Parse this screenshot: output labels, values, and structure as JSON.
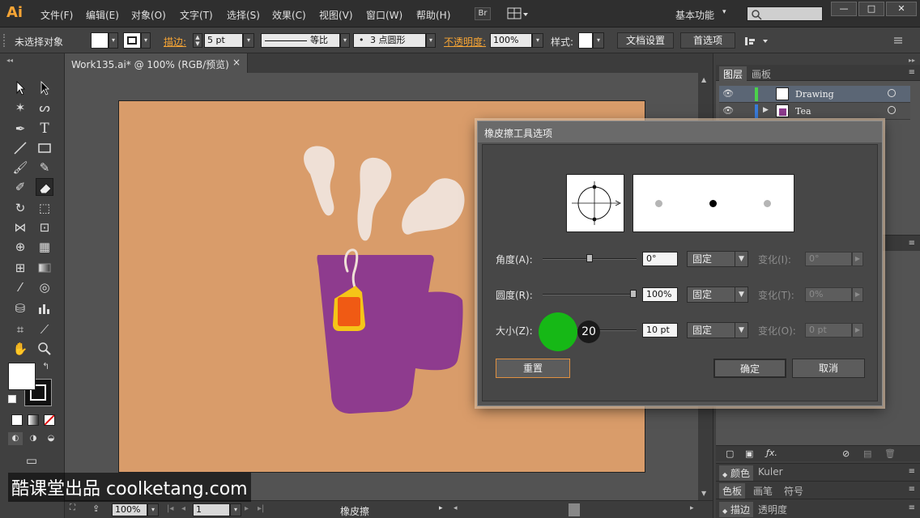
{
  "app": {
    "logo": "Ai",
    "menus": [
      "文件(F)",
      "编辑(E)",
      "对象(O)",
      "文字(T)",
      "选择(S)",
      "效果(C)",
      "视图(V)",
      "窗口(W)",
      "帮助(H)"
    ],
    "bridge_label": "Br",
    "workspace": "基本功能",
    "window_controls": [
      "—",
      "□",
      "✕"
    ]
  },
  "control_bar": {
    "selection_status": "未选择对象",
    "stroke_label": "描边:",
    "stroke_weight": "5 pt",
    "profile_label": "等比",
    "brush_label": "3 点圆形",
    "opacity_label": "不透明度:",
    "opacity_value": "100%",
    "style_label": "样式:",
    "doc_setup_button": "文档设置",
    "preferences_button": "首选项"
  },
  "document_tab": {
    "title": "Work135.ai* @ 100% (RGB/预览)",
    "close": "×"
  },
  "status_bar": {
    "zoom": "100%",
    "artboard_number": "1",
    "current_tool": "橡皮擦"
  },
  "layers_panel": {
    "tabs": [
      "图层",
      "画板"
    ],
    "layers": [
      {
        "name": "Drawing",
        "color": "#4bd14b"
      },
      {
        "name": "Tea",
        "color": "#3a7bd9"
      }
    ]
  },
  "lower_panels": {
    "color_tabs": [
      "颜色",
      "Kuler"
    ],
    "swatch_tabs": [
      "色板",
      "画笔",
      "符号"
    ],
    "stroke_tabs": [
      "描边",
      "透明度"
    ]
  },
  "dialog": {
    "title": "橡皮擦工具选项",
    "rows": [
      {
        "label": "角度(A):",
        "value": "0°",
        "mode": "固定",
        "variation_label": "变化(I):",
        "variation_value": "0°",
        "thumb": 0.5
      },
      {
        "label": "圆度(R):",
        "value": "100%",
        "mode": "固定",
        "variation_label": "变化(T):",
        "variation_value": "0%",
        "thumb": 1.0
      },
      {
        "label": "大小(Z):",
        "value": "10 pt",
        "mode": "固定",
        "variation_label": "变化(O):",
        "variation_value": "0 pt",
        "thumb": 0.1
      }
    ],
    "size_badge": "20",
    "reset_button": "重置",
    "ok_button": "确定",
    "cancel_button": "取消"
  },
  "colors": {
    "artboard": "#d99c6a",
    "mug": "#8e3b8e",
    "steam": "#efe0d6",
    "tag_yellow": "#f5c518",
    "tag_orange": "#f05a14",
    "highlight_green": "#16b816"
  },
  "watermark": "酷课堂出品 coolketang.com"
}
